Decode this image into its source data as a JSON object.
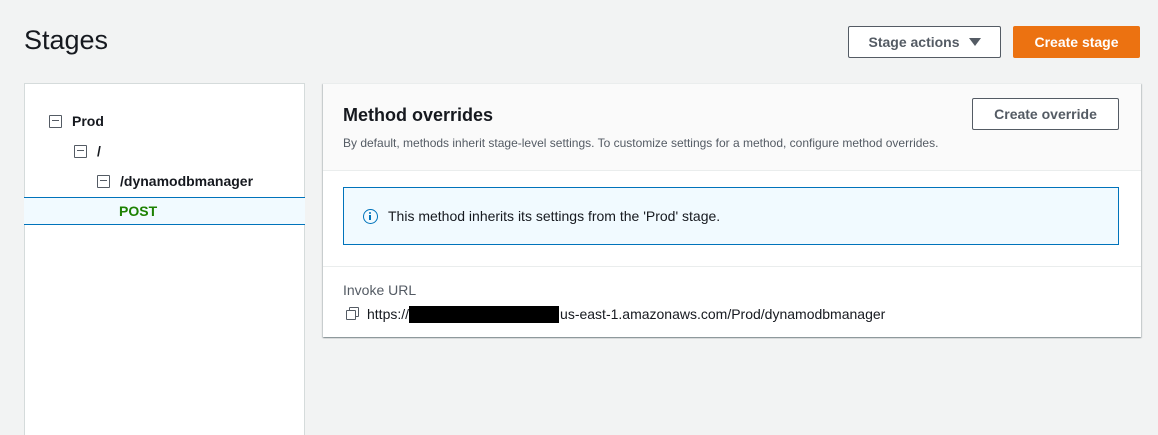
{
  "header": {
    "title": "Stages",
    "stage_actions_label": "Stage actions",
    "create_stage_label": "Create stage"
  },
  "tree": {
    "stage": "Prod",
    "root": "/",
    "resource": "/dynamodbmanager",
    "method": "POST"
  },
  "method_overrides": {
    "title": "Method overrides",
    "description": "By default, methods inherit stage-level settings. To customize settings for a method, configure method overrides.",
    "create_override_label": "Create override",
    "info_message": "This method inherits its settings from the 'Prod' stage."
  },
  "invoke": {
    "label": "Invoke URL",
    "url_prefix": "https://",
    "url_suffix": "us-east-1.amazonaws.com/Prod/dynamodbmanager"
  },
  "colors": {
    "primary": "#ec7211",
    "method_green": "#1d8102",
    "info_blue": "#0073bb"
  },
  "icons": [
    "collapse-icon",
    "caret-down-icon",
    "info-icon",
    "copy-icon"
  ]
}
